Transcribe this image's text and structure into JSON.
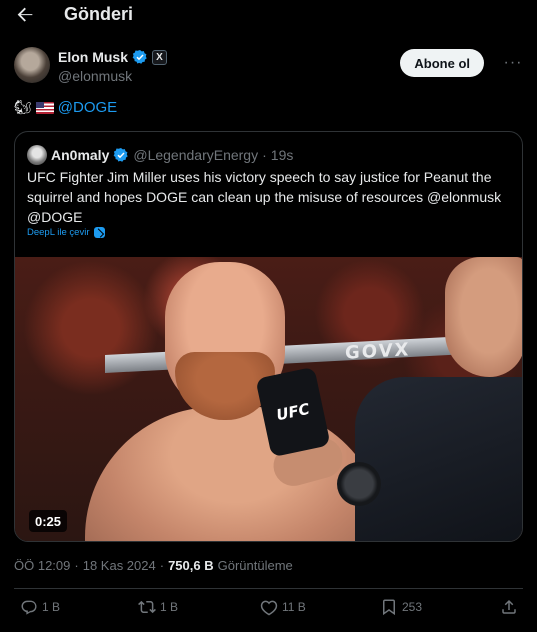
{
  "header": {
    "title": "Gönderi",
    "back_icon": "arrow-left-icon"
  },
  "author": {
    "name": "Elon Musk",
    "handle": "@elonmusk",
    "verified_color": "#1d9bf0",
    "affiliate_badge": "X",
    "follow_label": "Abone ol",
    "more_icon": "ellipsis-icon"
  },
  "post": {
    "emoji_squirrel": "🐿",
    "mention": "@DOGE"
  },
  "quote": {
    "name": "An0maly",
    "handle": "@LegendaryEnergy",
    "separator": "·",
    "time": "19s",
    "text": "UFC Fighter Jim Miller uses his victory speech to say justice for Peanut the squirrel and hopes DOGE can clean up the misuse of resources @elonmusk @DOGE",
    "translate_label": "DeepL ile çevir",
    "media": {
      "duration": "0:25",
      "banner_text": "GOVX",
      "mic_label": "UFC"
    }
  },
  "meta": {
    "time": "ÖÖ 12:09",
    "separator": "·",
    "date": "18 Kas 2024",
    "separator2": "·",
    "views_count": "750,6 B",
    "views_label": "Görüntüleme"
  },
  "actions": {
    "replies": "1 B",
    "reposts": "1 B",
    "likes": "11 B",
    "bookmarks": "253"
  },
  "colors": {
    "background": "#000000",
    "text": "#e7e9ea",
    "secondary": "#71767b",
    "accent": "#1d9bf0",
    "border": "#2f3336"
  }
}
